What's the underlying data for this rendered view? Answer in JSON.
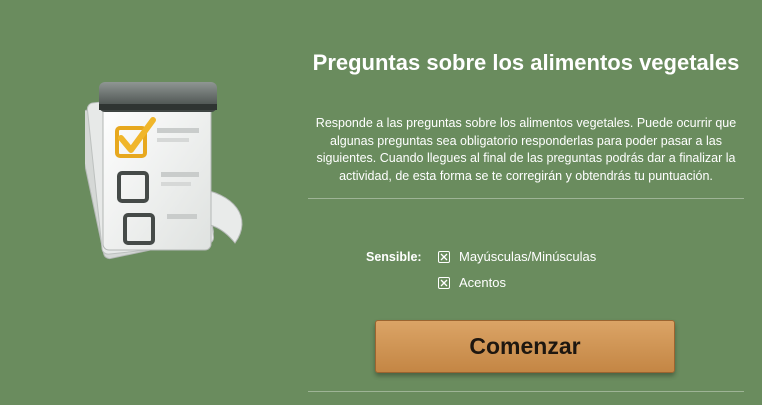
{
  "title": "Preguntas sobre los alimentos vegetales",
  "description": "Responde a las preguntas sobre los alimentos vegetales. Puede ocurrir que algunas preguntas sea obligatorio responderlas para poder pasar a las siguientes. Cuando llegues al final de las preguntas podrás dar a finalizar la actividad, de esta forma se te corregirán y obtendrás tu puntuación.",
  "options": {
    "label": "Sensible:",
    "items": [
      {
        "label": "Mayúsculas/Minúsculas"
      },
      {
        "label": "Acentos"
      }
    ]
  },
  "start_button": {
    "label": "Comenzar"
  },
  "colors": {
    "background": "#6a8c5e",
    "button": "#d19a5a",
    "check_accent": "#f0b62a"
  },
  "icons": {
    "illustration": "checklist-notepad-icon",
    "checkbox": "checkbox-x-icon"
  }
}
